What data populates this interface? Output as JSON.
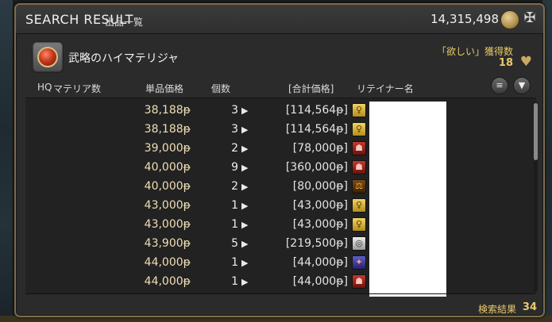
{
  "window": {
    "title": "SEARCH RESULT",
    "subtitle": "出品一覧",
    "gil": "14,315,498",
    "gil_icon": "gil-coin-icon",
    "close_icon": "close-icon"
  },
  "item": {
    "name": "武略のハイマテリジャ",
    "icon": "materia-icon",
    "wanted_label": "「欲しい」獲得数",
    "wanted_count": "18",
    "wanted_icon": "heart-icon"
  },
  "columns": {
    "hq": "HQ",
    "materia": "マテリア数",
    "unit_price": "単品価格",
    "quantity": "個数",
    "total_price": "[合計価格]",
    "retainer": "リテイナー名"
  },
  "tools": {
    "history_icon": "history-icon",
    "filter_icon": "filter-icon"
  },
  "listings": [
    {
      "unit_price": "38,188",
      "qty": "3",
      "total": "[114,564",
      "retainer_icon": "gold"
    },
    {
      "unit_price": "38,188",
      "qty": "3",
      "total": "[114,564",
      "retainer_icon": "gold"
    },
    {
      "unit_price": "39,000",
      "qty": "2",
      "total": "[78,000",
      "retainer_icon": "red"
    },
    {
      "unit_price": "40,000",
      "qty": "9",
      "total": "[360,000",
      "retainer_icon": "red"
    },
    {
      "unit_price": "40,000",
      "qty": "2",
      "total": "[80,000",
      "retainer_icon": "orange"
    },
    {
      "unit_price": "43,000",
      "qty": "1",
      "total": "[43,000",
      "retainer_icon": "gold"
    },
    {
      "unit_price": "43,000",
      "qty": "1",
      "total": "[43,000",
      "retainer_icon": "gold"
    },
    {
      "unit_price": "43,900",
      "qty": "5",
      "total": "[219,500",
      "retainer_icon": "white"
    },
    {
      "unit_price": "44,000",
      "qty": "1",
      "total": "[44,000",
      "retainer_icon": "blue"
    },
    {
      "unit_price": "44,000",
      "qty": "1",
      "total": "[44,000",
      "retainer_icon": "red"
    }
  ],
  "currency_glyph": "ᵽ",
  "total_suffix": "]",
  "qty_arrow": "▶",
  "footer": {
    "label": "検索結果",
    "count": "34"
  }
}
